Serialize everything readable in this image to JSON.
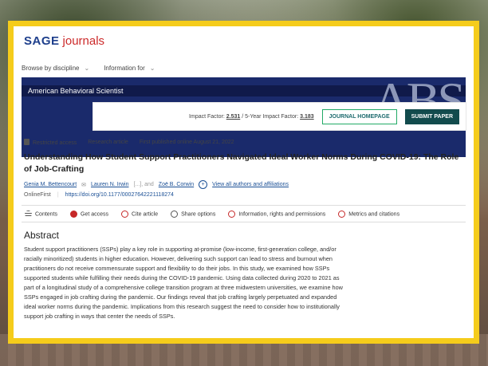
{
  "header": {
    "logo_brand": "SAGE",
    "logo_product": "journals"
  },
  "nav": {
    "browse": "Browse by discipline",
    "info": "Information for"
  },
  "banner": {
    "journal_title": "American Behavioral Scientist",
    "abbr": "ABS"
  },
  "infobar": {
    "impact_label": "Impact Factor:",
    "impact_value": "2.531",
    "five_year_label": "5-Year Impact Factor:",
    "five_year_value": "3.183",
    "home_button": "JOURNAL HOMEPAGE",
    "submit_button": "SUBMIT PAPER"
  },
  "meta": {
    "access": "Restricted access",
    "type": "Research article",
    "published": "First published online August 21, 2022"
  },
  "article": {
    "title": "Understanding How Student Support Practitioners Navigated Ideal Worker Norms During COVID-19: The Role of Job-Crafting",
    "authors": [
      "Genia M. Bettencourt",
      "Lauren N. Irwin",
      "Zoë B. Corwin"
    ],
    "ellipsis": "[...], and",
    "view_all": "View all authors and affiliations",
    "status": "OnlineFirst",
    "doi": "https://doi.org/10.1177/00027642221118274"
  },
  "toolbar": {
    "contents": "Contents",
    "access": "Get access",
    "cite": "Cite article",
    "share": "Share options",
    "info": "Information, rights and permissions",
    "metrics": "Metrics and citations"
  },
  "abstract": {
    "heading": "Abstract",
    "text": "Student support practitioners (SSPs) play a key role in supporting at-promise (low-income, first-generation college, and/or racially minoritized) students in higher education. However, delivering such support can lead to stress and burnout when practitioners do not receive commensurate support and flexibility to do their jobs. In this study, we examined how SSPs supported students while fulfilling their needs during the COVID-19 pandemic. Using data collected during 2020 to 2021 as part of a longitudinal study of a comprehensive college transition program at three midwestern universities, we examine how SSPs engaged in job crafting during the pandemic. Our findings reveal that job crafting largely perpetuated and expanded ideal worker norms during the pandemic. Implications from this research suggest the need to consider how to institutionally support job crafting in ways that center the needs of SSPs."
  }
}
